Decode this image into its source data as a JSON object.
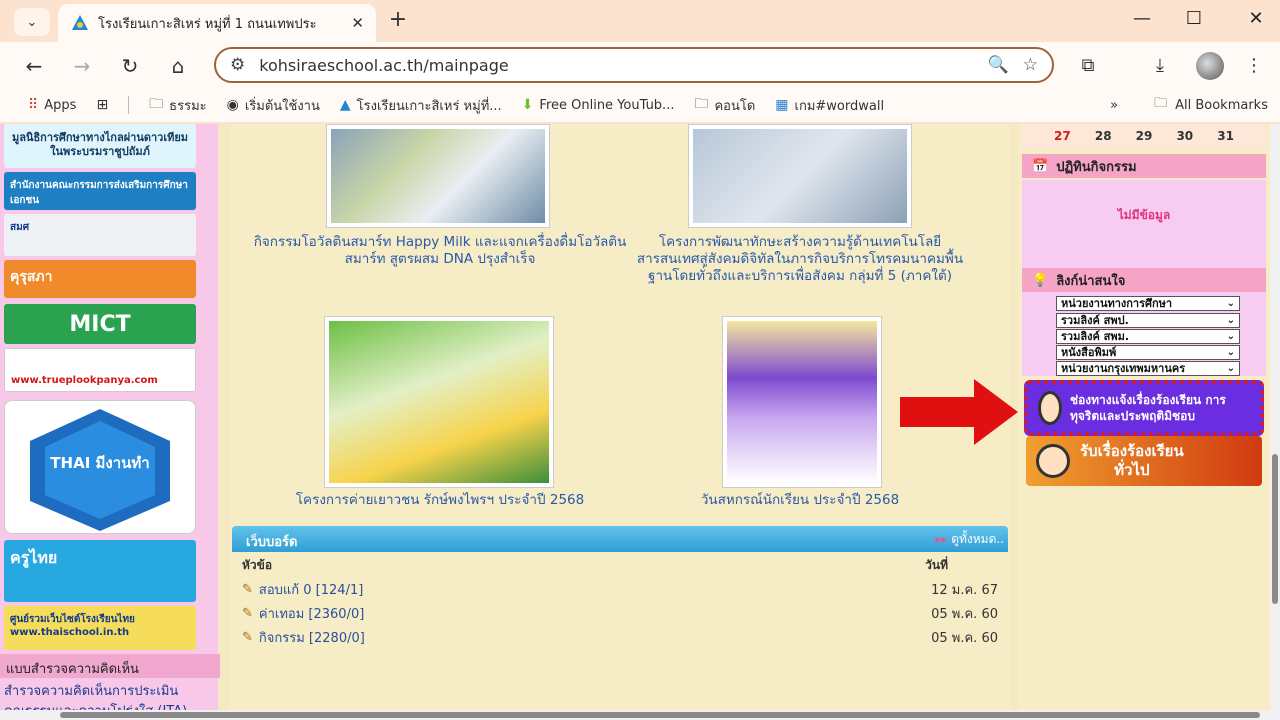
{
  "browser": {
    "tab_title": "โรงเรียนเกาะสิเหร่ หมู่ที่ 1 ถนนเทพประ",
    "tab_dropdown_icon": "chevron-down-icon",
    "url": "kohsiraeschool.ac.th/mainpage",
    "bookmarks": [
      {
        "label": "Apps",
        "icon": "apps-grid-icon"
      },
      {
        "label": "ธรรมะ",
        "icon": "folder-icon"
      },
      {
        "label": "เริ่มต้นใช้งาน",
        "icon": "chrome-icon"
      },
      {
        "label": "โรงเรียนเกาะสิเหร่ หมู่ที่...",
        "icon": "school-logo-icon"
      },
      {
        "label": "Free Online YouTub...",
        "icon": "download-arrow-icon"
      },
      {
        "label": "คอนโด",
        "icon": "folder-icon"
      },
      {
        "label": "เกม#wordwall",
        "icon": "wordwall-icon"
      }
    ],
    "all_bookmarks": "All Bookmarks"
  },
  "left": {
    "banner1": "มูลนิธิการศึกษาทางไกลผ่านดาวเทียม ในพระบรมราชูปถัมภ์",
    "banner_opec": "สำนักงานคณะกรรมการส่งเสริมการศึกษาเอกชน",
    "banner_sme": "สมศ",
    "banner_kurusapa": "คุรุสภา",
    "banner_mict": "MICT",
    "banner_true": "www.trueplookpanya.com",
    "banner_thai": "THAI มีงานทำ",
    "banner_krutai": "ครูไทย",
    "banner_thaischool": "ศูนย์รวมเว็บไซต์โรงเรียนไทย www.thaischool.in.th",
    "survey_head": "แบบสำรวจความคิดเห็น",
    "survey_link": "สำรวจความคิดเห็นการประเมินคุณธรรมและความโปร่งใส (ITA)"
  },
  "main": {
    "caption1": "กิจกรรมโอวัลตินสมาร์ท Happy Milk และแจกเครื่องดื่มโอวัลตินสมาร์ท สูตรผสม DNA ปรุงสำเร็จ",
    "caption2": "โครงการพัฒนาทักษะสร้างความรู้ด้านเทคโนโลยีสารสนเทศสู่สังคมดิจิทัลในภารกิจบริการโทรคมนาคมพื้นฐานโดยทั่วถึงและบริการเพื่อสังคม กลุ่มที่ 5 (ภาคใต้)",
    "caption3": "โครงการค่ายเยาวชน รักษ์พงไพรฯ ประจำปี 2568",
    "caption4": "วันสหกรณ์นักเรียน ประจำปี 2568",
    "webboard": {
      "title": "เว็บบอร์ด",
      "view_all": "ดูทั้งหมด..",
      "col_topic": "หัวข้อ",
      "col_date": "วันที่",
      "rows": [
        {
          "topic": "สอบแก้ 0 [124/1]",
          "date": "12 ม.ค. 67"
        },
        {
          "topic": "ค่าเทอม [2360/0]",
          "date": "05 พ.ค. 60"
        },
        {
          "topic": "กิจกรรม [2280/0]",
          "date": "05 พ.ค. 60"
        }
      ]
    }
  },
  "right": {
    "cal_days": [
      "27",
      "28",
      "29",
      "30",
      "31"
    ],
    "calendar_head": "ปฏิทินกิจกรรม",
    "no_data": "ไม่มีข้อมูล",
    "links_head": "ลิงก์น่าสนใจ",
    "selects": [
      "หน่วยงานทางการศึกษา",
      "รวมลิงค์ สพป.",
      "รวมลิงค์ สพม.",
      "หนังสือพิมพ์",
      "หน่วยงานกรุงเทพมหานคร"
    ],
    "complaint_btn": "ช่องทางแจ้งเรื่องร้องเรียน การทุจริตและประพฤติมิชอบ",
    "general_btn_1": "รับเรื่องร้องเรียน",
    "general_btn_2": "ทั่วไป"
  },
  "colors": {
    "arrow": "#e01010",
    "accent": "#6a2ee0"
  }
}
